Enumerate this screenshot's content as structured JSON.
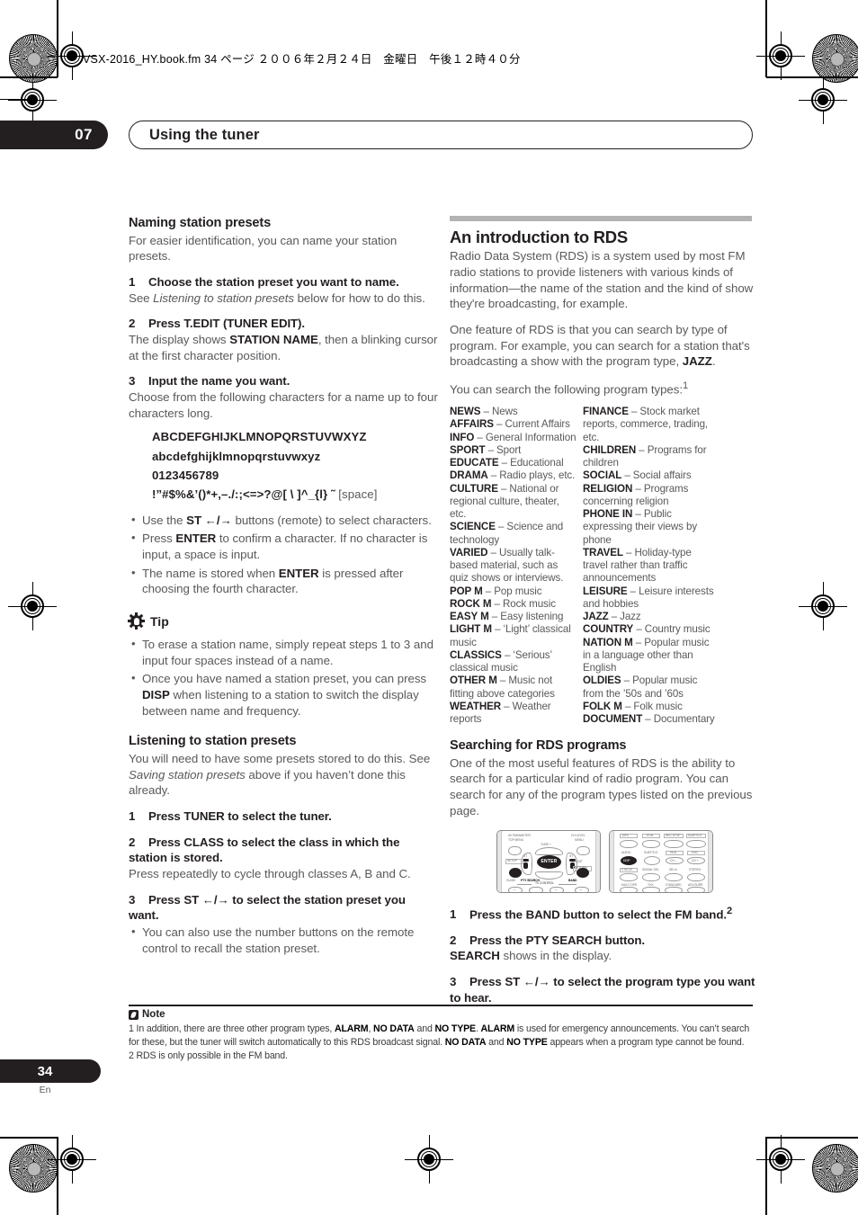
{
  "print_header": {
    "filename_line": "VSX-2016_HY.book.fm 34 ページ ２００６年２月２４日　金曜日　午後１２時４０分"
  },
  "chapter": {
    "number": "07",
    "title": "Using the tuner"
  },
  "left_column": {
    "section1": {
      "heading": "Naming station presets",
      "intro": "For easier identification, you can name your station presets.",
      "step1_num": "1",
      "step1_title": "Choose the station preset you want to name.",
      "step1_body_pre": "See ",
      "step1_body_italic": "Listening to station presets",
      "step1_body_post": " below for how to do this.",
      "step2_num": "2",
      "step2_title": "Press T.EDIT (TUNER EDIT).",
      "step2_body_pre": "The display shows ",
      "step2_body_bold": "STATION NAME",
      "step2_body_post": ", then a blinking cursor at the first character position.",
      "step3_num": "3",
      "step3_title": "Input the name you want.",
      "step3_body": "Choose from the following characters for a name up to four characters long.",
      "charset": {
        "uppercase": "ABCDEFGHIJKLMNOPQRSTUVWXYZ",
        "lowercase": "abcdefghijklmnopqrstuvwxyz",
        "digits": "0123456789",
        "symbols": "!”#$%&’()*+,–./:;<=>?@[ \\ ]^_{l} ˜",
        "space_label": "[space]"
      },
      "bullets": [
        {
          "pre": "Use the ",
          "bold": "ST",
          "mid": " ←/→ ",
          "post": "buttons (remote) to select characters."
        },
        {
          "pre": "Press ",
          "bold": "ENTER",
          "mid": " ",
          "post": "to confirm a character. If no character is input, a space is input."
        },
        {
          "pre": "The name is stored when ",
          "bold": "ENTER",
          "mid": " ",
          "post": "is pressed after choosing the fourth character."
        }
      ],
      "tip_label": "Tip",
      "tip_bullets": [
        {
          "pre": "To erase a station name, simply repeat steps 1 to 3 and input four spaces instead of a name.",
          "bold": "",
          "post": ""
        },
        {
          "pre": "Once you have named a station preset, you can press ",
          "bold": "DISP",
          "post": " when listening to a station to switch the display between name and frequency."
        }
      ]
    },
    "section2": {
      "heading": "Listening to station presets",
      "intro_pre": "You will need to have some presets stored to do this. See ",
      "intro_italic": "Saving station presets",
      "intro_post": " above if you haven’t done this already.",
      "step1_num": "1",
      "step1_title": "Press TUNER to select the tuner.",
      "step2_num": "2",
      "step2_title": "Press CLASS to select the class in which the station is stored.",
      "step2_body": "Press repeatedly to cycle through classes A, B and C.",
      "step3_num": "3",
      "step3_title": "Press ST ←/→ to select the station preset you want.",
      "step3_bullet": "You can also use the number buttons on the remote control to recall the station preset."
    }
  },
  "right_column": {
    "rds_intro": {
      "heading": "An introduction to RDS",
      "para1": "Radio Data System (RDS) is a system used by most FM radio stations to provide listeners with various kinds of information—the name of the station and the kind of show they're broadcasting, for example.",
      "para2_pre": "One feature of RDS is that you can search by type of program. For example, you can search for a station that's broadcasting a show with the program type, ",
      "para2_bold": "JAZZ",
      "para2_post": ".",
      "para3": "You can search the following program types:",
      "para3_sup": "1"
    },
    "program_types_col1": [
      {
        "code": "NEWS",
        "dash": " – ",
        "desc": "News"
      },
      {
        "code": "AFFAIRS",
        "dash": " – ",
        "desc": "Current Affairs"
      },
      {
        "code": "INFO",
        "dash": " – ",
        "desc": "General Information"
      },
      {
        "code": "SPORT",
        "dash": " – ",
        "desc": "Sport"
      },
      {
        "code": "EDUCATE",
        "dash": " – ",
        "desc": "Educational"
      },
      {
        "code": "DRAMA",
        "dash": " – ",
        "desc": "Radio plays, etc."
      },
      {
        "code": "CULTURE",
        "dash": " – ",
        "desc": "National or regional culture, theater, etc."
      },
      {
        "code": "SCIENCE",
        "dash": " – ",
        "desc": "Science and technology"
      },
      {
        "code": "VARIED",
        "dash": " – ",
        "desc": "Usually talk-based material, such as quiz shows or interviews."
      },
      {
        "code": "POP M",
        "dash": " – ",
        "desc": "Pop music"
      },
      {
        "code": "ROCK M",
        "dash": " – ",
        "desc": "Rock music"
      },
      {
        "code": "EASY M",
        "dash": " – ",
        "desc": "Easy listening"
      },
      {
        "code": "LIGHT M",
        "dash": " – ",
        "desc": "‘Light’ classical music"
      },
      {
        "code": "CLASSICS",
        "dash": " – ",
        "desc": "‘Serious’ classical music"
      },
      {
        "code": "OTHER M",
        "dash": " – ",
        "desc": "Music not fitting above categories"
      },
      {
        "code": "WEATHER",
        "dash": " – ",
        "desc": "Weather reports"
      }
    ],
    "program_types_col2": [
      {
        "code": "FINANCE",
        "dash": " – ",
        "desc": "Stock market reports, commerce, trading, etc."
      },
      {
        "code": "CHILDREN",
        "dash": " – ",
        "desc": "Programs for children"
      },
      {
        "code": "SOCIAL",
        "dash": " – ",
        "desc": "Social affairs"
      },
      {
        "code": "RELIGION",
        "dash": " – ",
        "desc": "Programs concerning religion"
      },
      {
        "code": "PHONE IN",
        "dash": " – ",
        "desc": "Public expressing their views by phone"
      },
      {
        "code": "TRAVEL",
        "dash": " – ",
        "desc": "Holiday-type travel rather than traffic announcements"
      },
      {
        "code": "LEISURE",
        "dash": " – ",
        "desc": "Leisure interests and hobbies"
      },
      {
        "code": "JAZZ",
        "dash": " – ",
        "desc": "Jazz"
      },
      {
        "code": "COUNTRY",
        "dash": " – ",
        "desc": "Country music"
      },
      {
        "code": "NATION M",
        "dash": " – ",
        "desc": "Popular music in a language other than English"
      },
      {
        "code": "OLDIES",
        "dash": " – ",
        "desc": "Popular music from the ’50s and ’60s"
      },
      {
        "code": "FOLK M",
        "dash": " – ",
        "desc": "Folk music"
      },
      {
        "code": "DOCUMENT",
        "dash": " – ",
        "desc": "Documentary"
      }
    ],
    "searching": {
      "heading": "Searching for RDS programs",
      "intro": "One of the most useful features of RDS is the ability to search for a particular kind of radio program. You can search for any of the program types listed on the previous page.",
      "step1_num": "1",
      "step1_title": "Press the BAND button to select the FM band.",
      "step1_sup": "2",
      "step2_num": "2",
      "step2_title": "Press the PTY SEARCH button.",
      "step2_body_bold": "SEARCH",
      "step2_body_post": " shows in the display.",
      "step3_num": "3",
      "step3_title": "Press ST ←/→ to select the program type you want to hear."
    },
    "remote_figure": {
      "left_labels": [
        "AV PARAMETER",
        "TOP MENU",
        "CH LEVEL",
        "MENU",
        "TUNE +",
        "TUNE –",
        "ST",
        "ST",
        "ENTER",
        "SETUP",
        "T.EDIT",
        "RETURN",
        "GUIDE",
        "PTY SEARCH",
        "BAND",
        "TV CONTROL"
      ],
      "right_labels": [
        "MPX",
        "EON",
        "REC STOP",
        "SUBTITLE",
        "AUDIO",
        "SUBTITLE",
        "HDD",
        "DVD",
        "DISP",
        "CH –",
        "CH +",
        "STATUS",
        "SIGNAL SEL",
        "SB ch",
        "STEREO",
        "MULTI OPE",
        "THX",
        "STANDARD",
        "ADV.SURR"
      ]
    }
  },
  "note": {
    "label": "Note",
    "line1_parts": [
      {
        "t": "1 In addition, there are three other program types, ",
        "b": false
      },
      {
        "t": "ALARM",
        "b": true
      },
      {
        "t": ", ",
        "b": false
      },
      {
        "t": "NO DATA",
        "b": true
      },
      {
        "t": " and ",
        "b": false
      },
      {
        "t": "NO TYPE",
        "b": true
      },
      {
        "t": ". ",
        "b": false
      },
      {
        "t": "ALARM",
        "b": true
      },
      {
        "t": " is used for emergency announcements. You can’t search for these, but the tuner will switch automatically to this RDS broadcast signal. ",
        "b": false
      },
      {
        "t": "NO DATA",
        "b": true
      },
      {
        "t": " and ",
        "b": false
      },
      {
        "t": "NO TYPE",
        "b": true
      },
      {
        "t": " appears when a program type cannot be found.",
        "b": false
      }
    ],
    "line2": "2 RDS is only possible in the FM band."
  },
  "footer": {
    "page_number": "34",
    "language": "En"
  }
}
